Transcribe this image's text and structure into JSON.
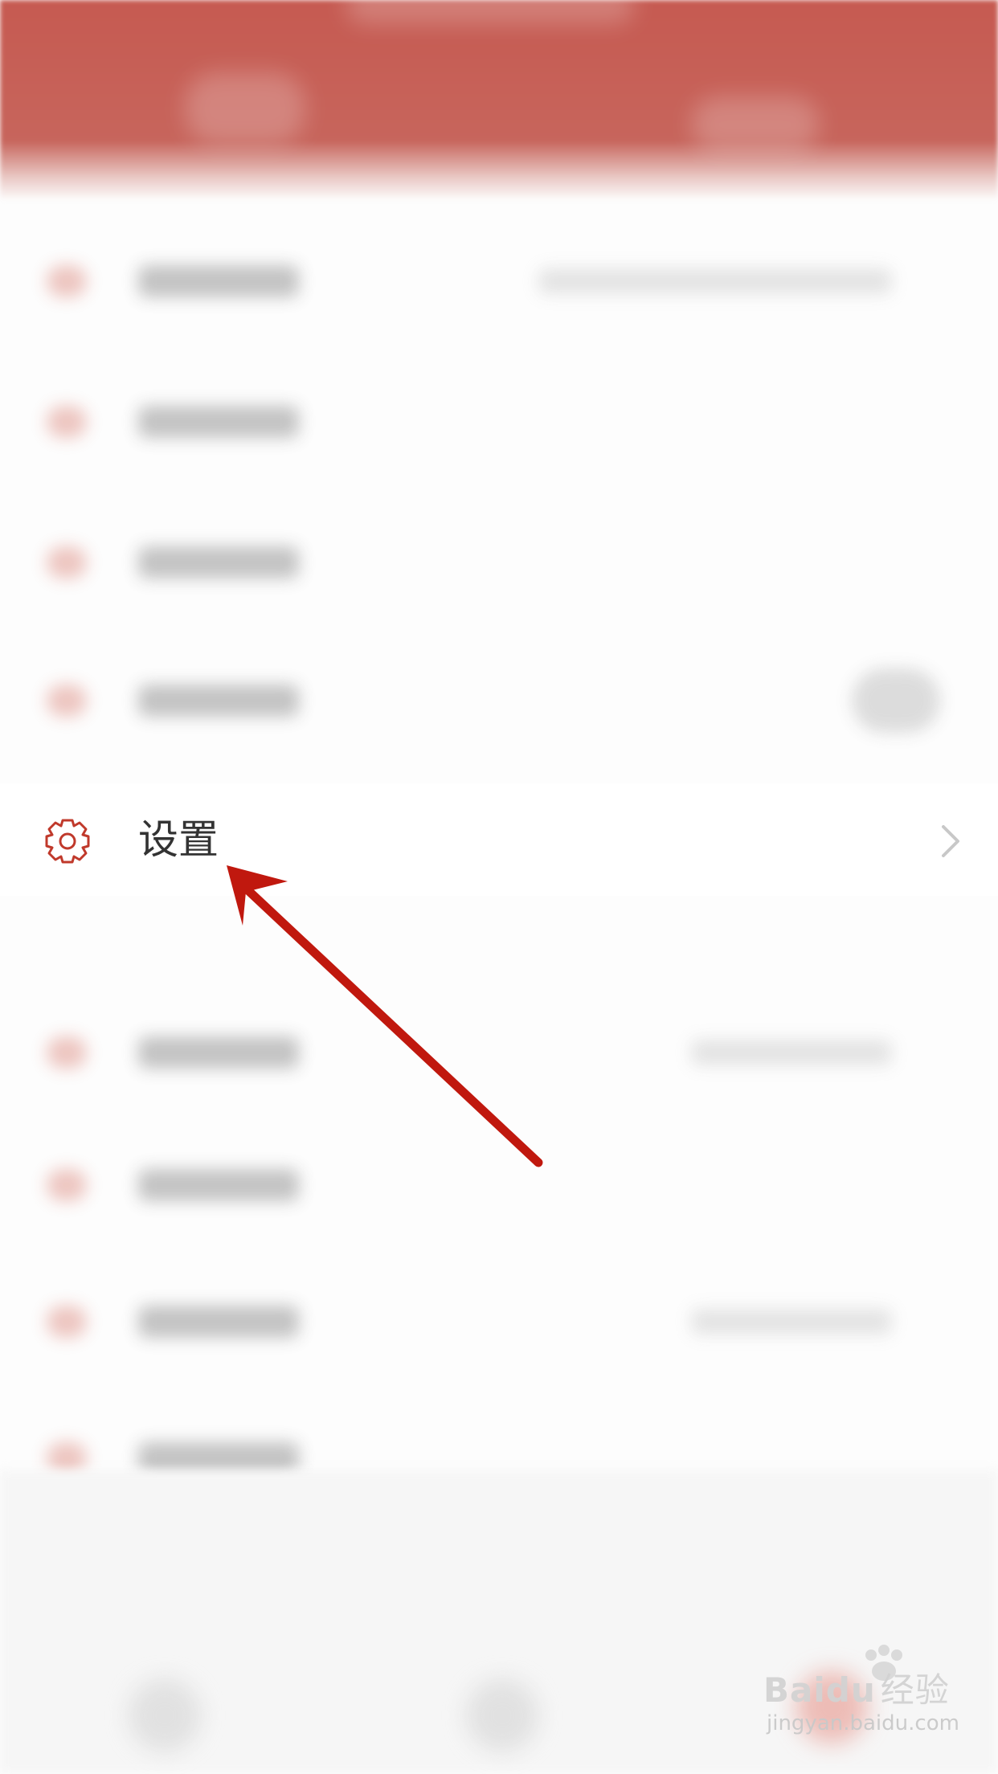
{
  "menu": {
    "settings_label": "设置"
  },
  "watermark": {
    "brand": "Baidu",
    "brand_cn": "经验",
    "url": "jingyan.baidu.com"
  },
  "icons": {
    "settings": "gear-icon",
    "chevron": "chevron-right-icon",
    "annotation": "red-arrow-annotation"
  },
  "colors": {
    "header": "#c65a51",
    "accent": "#c0392b",
    "arrow": "#c0180e",
    "text": "#333333",
    "chevron": "#c8c8c8"
  }
}
